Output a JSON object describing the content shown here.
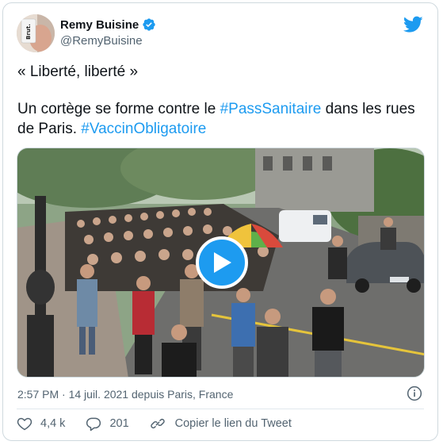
{
  "author": {
    "name": "Remy Buisine",
    "handle": "@RemyBuisine",
    "avatar_sign_text": "Brut."
  },
  "tweet": {
    "line1": "« Liberté, liberté »",
    "line2_a": "Un cortège se forme contre le ",
    "hashtag1": "#PassSanitaire",
    "line2_b": " dans les rues de Paris. ",
    "hashtag2": "#VaccinObligatoire"
  },
  "meta": {
    "timestamp": "2:57 PM · 14 juil. 2021 depuis Paris, France"
  },
  "actions": {
    "likes": "4,4 k",
    "replies": "201",
    "copy_link": "Copier le lien du Tweet"
  },
  "colors": {
    "accent": "#1d9bf0",
    "text": "#0f1419",
    "muted": "#536471",
    "border": "#cfd9de"
  },
  "icons": [
    "twitter-bird-icon",
    "verified-badge-icon",
    "play-icon",
    "info-icon",
    "heart-icon",
    "reply-icon",
    "link-icon"
  ]
}
